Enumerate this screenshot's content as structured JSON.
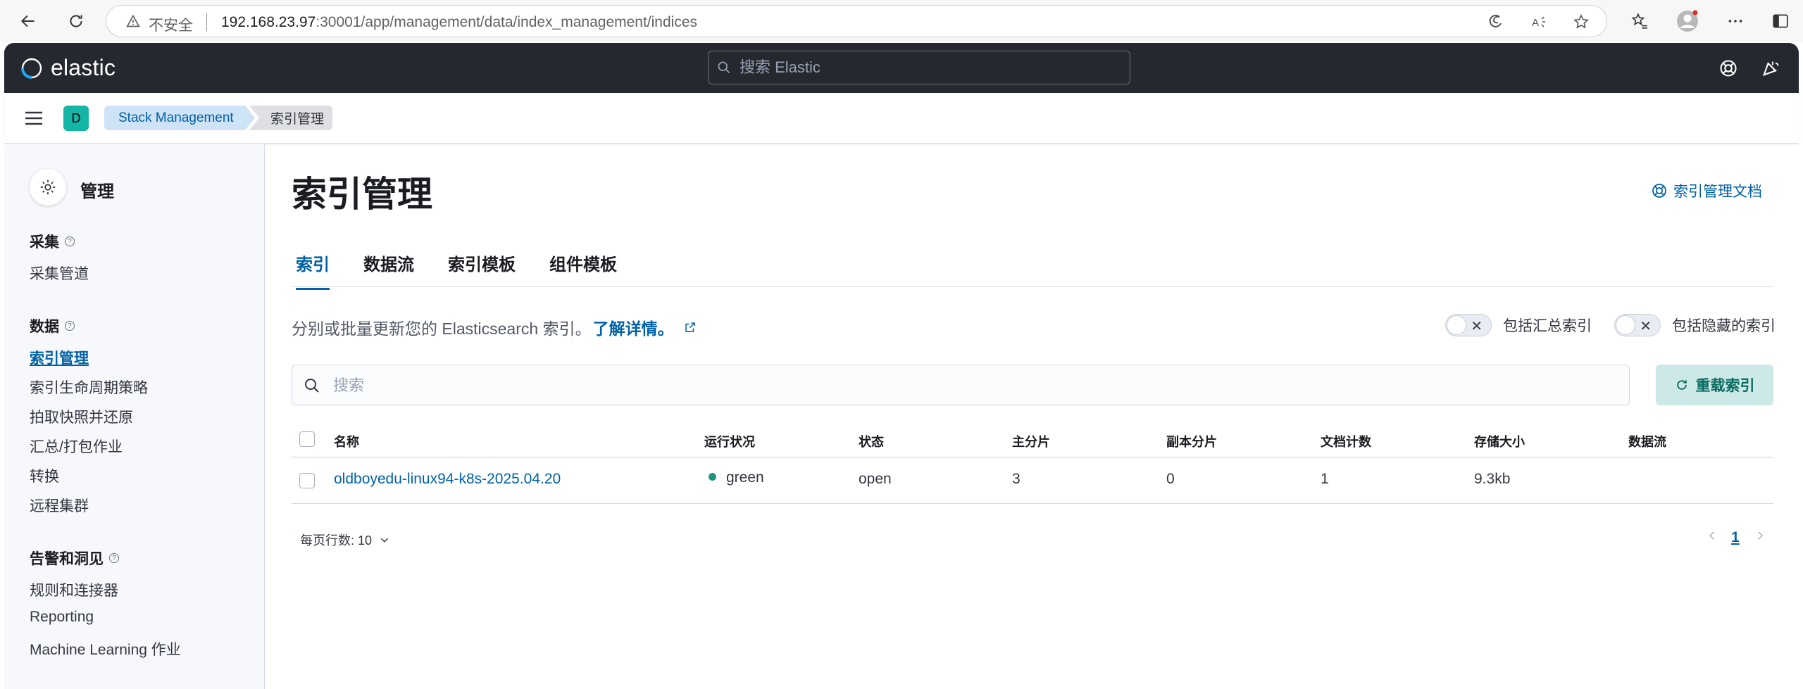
{
  "browser": {
    "insecure_label": "不安全",
    "url_host": "192.168.23.97",
    "url_path": ":30001/app/management/data/index_management/indices"
  },
  "header": {
    "logo_text": "elastic",
    "search_placeholder": "搜索 Elastic"
  },
  "breadcrumbs": {
    "space_initial": "D",
    "items": [
      "Stack Management",
      "索引管理"
    ]
  },
  "sidebar": {
    "title": "管理",
    "groups": [
      {
        "label": "采集",
        "items": [
          "采集管道"
        ]
      },
      {
        "label": "数据",
        "items": [
          "索引管理",
          "索引生命周期策略",
          "拍取快照并还原",
          "汇总/打包作业",
          "转换",
          "远程集群"
        ]
      },
      {
        "label": "告警和洞见",
        "items": [
          "规则和连接器",
          "Reporting",
          "Machine Learning 作业"
        ]
      }
    ],
    "active_item": "索引管理"
  },
  "main": {
    "title": "索引管理",
    "doc_link": "索引管理文档",
    "tabs": [
      "索引",
      "数据流",
      "索引模板",
      "组件模板"
    ],
    "active_tab": "索引",
    "description": "分别或批量更新您的 Elasticsearch 索引。",
    "learn_more": "了解详情。",
    "toggles": [
      "包括汇总索引",
      "包括隐藏的索引"
    ],
    "search_placeholder": "搜索",
    "reload_button": "重载索引"
  },
  "table": {
    "columns": [
      "名称",
      "运行状况",
      "状态",
      "主分片",
      "副本分片",
      "文档计数",
      "存储大小",
      "数据流"
    ],
    "rows": [
      {
        "name": "oldboyedu-linux94-k8s-2025.04.20",
        "health": "green",
        "status": "open",
        "primary": "3",
        "replicas": "0",
        "docs": "1",
        "size": "9.3kb",
        "data_stream": ""
      }
    ],
    "health_color": "#209280"
  },
  "pagination": {
    "rows_per_page": "每页行数: 10",
    "current_page": "1"
  },
  "colors": {
    "accent": "#0061a6",
    "header_bg": "#25282f",
    "space_avatar": "#14b5a5",
    "reload_bg": "#cce9e7"
  }
}
